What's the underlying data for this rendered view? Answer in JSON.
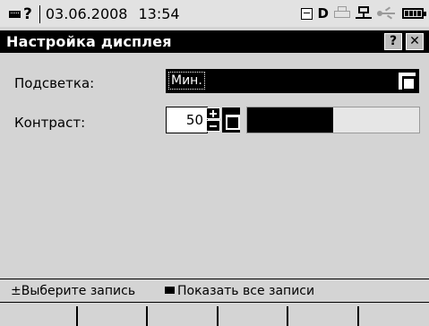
{
  "status_bar": {
    "help_mark": "?",
    "date": "03.06.2008",
    "time": "13:54",
    "drive_letter": "D",
    "icons": [
      "keyboard-icon",
      "floppy-icon",
      "printer-icon",
      "network-icon",
      "usb-icon",
      "battery-icon"
    ]
  },
  "window": {
    "title": "Настройка дисплея",
    "help_label": "?",
    "close_label": "✕"
  },
  "settings": {
    "backlight": {
      "label": "Подсветка:",
      "value": "Мин."
    },
    "contrast": {
      "label": "Контраст:",
      "value": "50",
      "level_fraction": 0.5
    }
  },
  "hints": {
    "select_symbol": "±",
    "select_text": "Выберите запись",
    "show_text": "Показать все записи"
  },
  "colors": {
    "background": "#d4d4d4",
    "titlebar": "#000000",
    "selection": "#000000"
  }
}
